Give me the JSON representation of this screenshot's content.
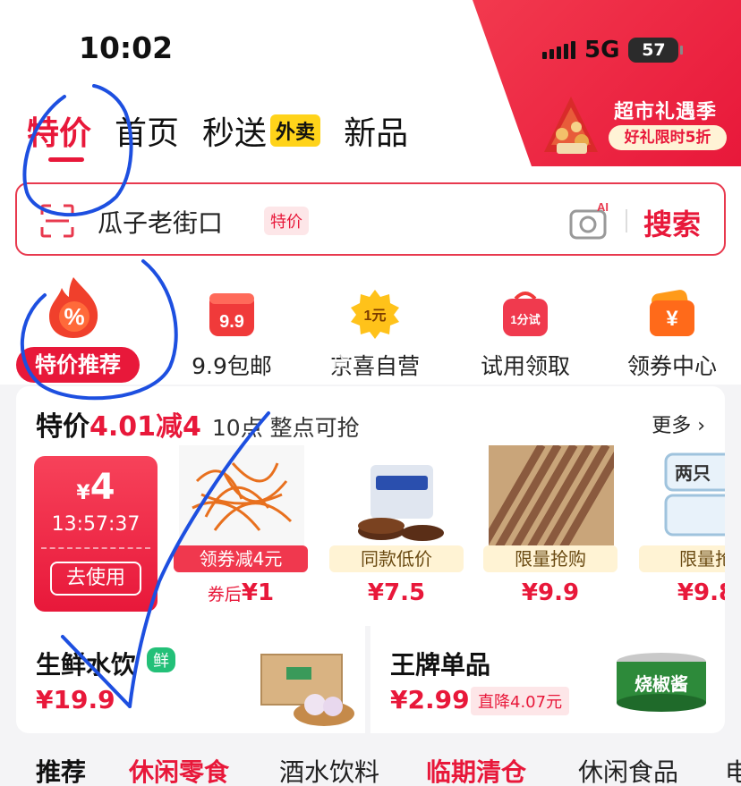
{
  "status_bar": {
    "time": "10:02",
    "network": "5G",
    "battery": "57"
  },
  "promo": {
    "title": "超市礼遇季",
    "subtitle": "好礼限时5折"
  },
  "top_tabs": [
    {
      "label": "特价"
    },
    {
      "label": "首页"
    },
    {
      "label": "秒送",
      "badge": "外卖"
    },
    {
      "label": "新品"
    }
  ],
  "search": {
    "query": "瓜子老街口",
    "tag": "特价",
    "button": "搜索"
  },
  "categories": [
    {
      "label": "特价推荐",
      "icon": "percent-flame-icon"
    },
    {
      "label": "9.9包邮",
      "icon": "nine-nine-icon",
      "icon_text": "9.9"
    },
    {
      "label": "京喜自营",
      "icon": "one-yuan-icon",
      "icon_text": "1元"
    },
    {
      "label": "试用领取",
      "icon": "trial-bag-icon",
      "icon_text": "1分试"
    },
    {
      "label": "领券中心",
      "icon": "coupon-yen-icon",
      "icon_text": "¥"
    }
  ],
  "category_overlay": "优选好货",
  "flash_sale": {
    "title_prefix": "特价",
    "title_highlight": "4.01减4",
    "subtitle": "10点 整点可抢",
    "more": "更多 ›",
    "coupon": {
      "currency": "¥",
      "amount": "4",
      "countdown": "13:57:37",
      "button": "去使用"
    },
    "products": [
      {
        "tag": "领券减4元",
        "tag_style": "red",
        "price_prefix": "券后",
        "price": "¥1"
      },
      {
        "tag": "同款低价",
        "tag_style": "cream",
        "price_prefix": "",
        "price": "¥7.5"
      },
      {
        "tag": "限量抢购",
        "tag_style": "cream",
        "price_prefix": "",
        "price": "¥9.9"
      },
      {
        "tag": "限量抢",
        "tag_style": "cream",
        "price_prefix": "",
        "price": "¥9.8"
      }
    ],
    "product_overlay": "两只"
  },
  "fresh": {
    "title": "生鲜水饮",
    "badge": "鲜",
    "price": "¥19.9"
  },
  "brand": {
    "title": "王牌单品",
    "price": "¥2.99",
    "drop": "直降4.07元",
    "product_text": "烧椒酱"
  },
  "bottom_tabs": [
    {
      "label": "推荐",
      "style": "active"
    },
    {
      "label": "休闲零食",
      "style": "red"
    },
    {
      "label": "酒水饮料",
      "style": "normal"
    },
    {
      "label": "临期清仓",
      "style": "red"
    },
    {
      "label": "休闲食品",
      "style": "normal"
    },
    {
      "label": "电",
      "style": "normal"
    }
  ],
  "colors": {
    "accent": "#e8183a",
    "annotation": "#1d4fe0",
    "fresh_badge": "#23c078"
  }
}
